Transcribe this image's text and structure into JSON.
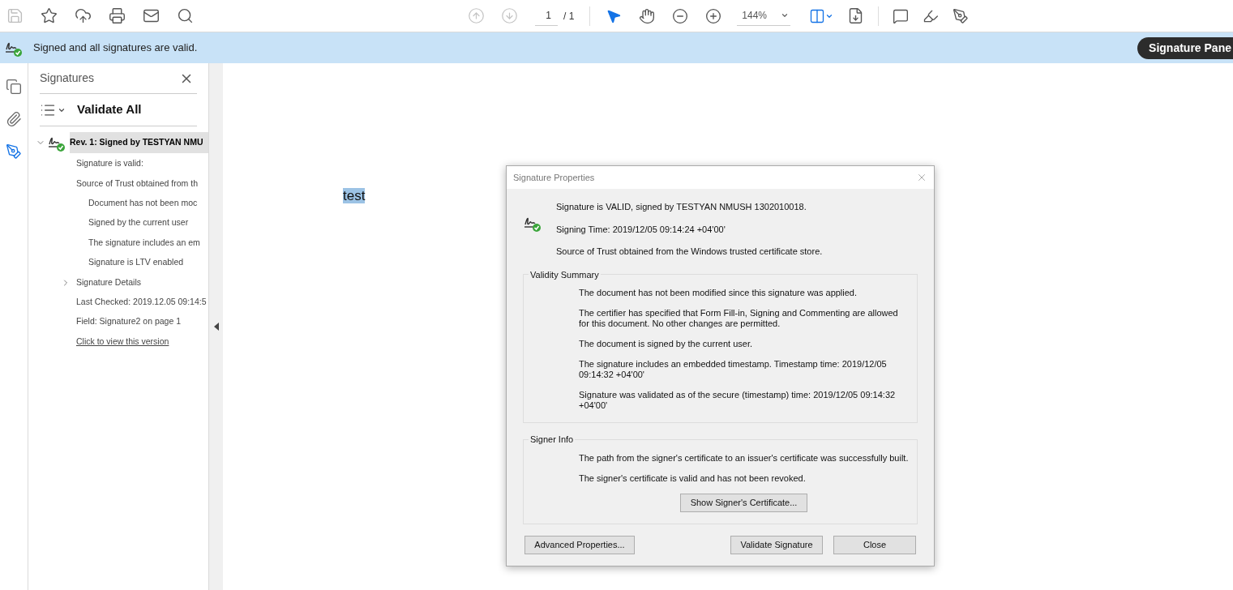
{
  "toolbar": {
    "left_tools": [
      {
        "disabled": true
      },
      {
        "disabled": false
      },
      {
        "disabled": false
      },
      {
        "disabled": false
      },
      {
        "disabled": false
      },
      {
        "disabled": false
      }
    ],
    "page_nav": [
      {
        "disabled": true
      },
      {
        "disabled": true
      }
    ],
    "page_number": "1",
    "page_count": "/ 1",
    "view_tools": [
      {
        "selected": true
      },
      {
        "selected": false
      },
      {
        "selected": false
      },
      {
        "selected": false
      }
    ],
    "zoom": "144%"
  },
  "message_bar": {
    "text": "Signed and all signatures are valid.",
    "button": "Signature Pane"
  },
  "left_rail": [
    {
      "selected": false
    },
    {
      "selected": false
    },
    {
      "selected": true
    }
  ],
  "signatures_panel": {
    "title": "Signatures",
    "validate_all": "Validate All",
    "tree": [
      {
        "label": "Rev. 1: Signed by TESTYAN NMU",
        "expanded": true,
        "selected": true,
        "children": [
          {
            "label": "Signature is valid:"
          },
          {
            "label": "Source of Trust obtained from th",
            "children": [
              {
                "label": "Document has not been moc"
              },
              {
                "label": "Signed by the current user"
              },
              {
                "label": "The signature includes an em"
              },
              {
                "label": "Signature is LTV enabled"
              }
            ]
          },
          {
            "label": "Signature Details",
            "expanded": false
          },
          {
            "label": "Last Checked: 2019.12.05 09:14:5"
          },
          {
            "label": "Field: Signature2 on page 1"
          },
          {
            "label": "Click to view this version",
            "kind": "link"
          }
        ]
      }
    ]
  },
  "document": {
    "text": "test",
    "selected": true
  },
  "dialog": {
    "title": "Signature Properties",
    "summary": [
      "Signature is VALID, signed by TESTYAN NMUSH 1302010018.",
      "Signing Time:  2019/12/05 09:14:24 +04'00'",
      "Source of Trust obtained from the Windows trusted certificate store."
    ],
    "sections": [
      {
        "title": "Validity Summary",
        "lines": [
          "The document has not been modified since this signature was applied.",
          "The certifier has specified that Form Fill-in, Signing and Commenting are allowed for this document. No other changes are permitted.",
          "The document is signed by the current user.",
          "The signature includes an embedded timestamp. Timestamp time: 2019/12/05 09:14:32 +04'00'",
          "Signature was validated as of the secure (timestamp) time: 2019/12/05 09:14:32 +04'00'"
        ]
      },
      {
        "title": "Signer Info",
        "lines": [
          "The path from the signer's certificate to an issuer's certificate was successfully built.",
          "The signer's certificate is valid and has not been revoked."
        ],
        "button": "Show Signer's Certificate..."
      }
    ],
    "buttons": {
      "left": "Advanced Properties...",
      "validate": "Validate Signature",
      "close": "Close"
    }
  }
}
